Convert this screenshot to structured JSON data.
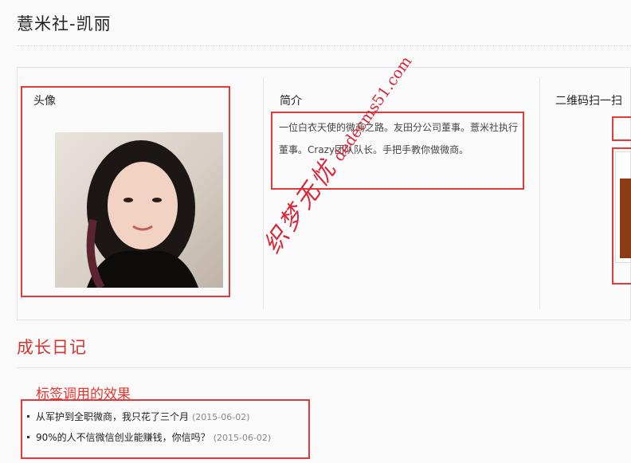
{
  "page": {
    "title": "薏米社-凯丽"
  },
  "profile": {
    "avatar_label": "头像",
    "avatar_alt": "凯丽头像",
    "intro_label": "简介",
    "intro_text": "一位白衣天使的微商之路。友田分公司董事。薏米社执行董事。Crazy团队队长。手把手教你做微商。",
    "qr_label": "二维码扫一扫"
  },
  "diary": {
    "title": "成长日记",
    "annotation": "标签调用的效果",
    "items": [
      {
        "title": "从军护到全职微商，我只花了三个月",
        "date": "(2015-06-02)"
      },
      {
        "title": "90%的人不信微信创业能赚钱，你信吗？",
        "date": "(2015-06-02)"
      }
    ]
  },
  "watermark": {
    "cn": "织梦无忧",
    "url": "dedecms51.com"
  },
  "colors": {
    "accent_red": "#d6342f",
    "annotation_red": "#e03a3a",
    "qr_brown": "#8c3b14"
  }
}
